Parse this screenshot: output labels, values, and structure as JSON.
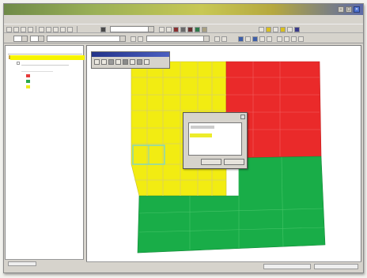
{
  "window": {
    "title": ""
  },
  "menubar": {
    "items": [
      "",
      "",
      "",
      "",
      "",
      "",
      ""
    ]
  },
  "toolbar": {
    "combo_values": [
      "",
      "",
      ""
    ]
  },
  "tree": {
    "root_label": "",
    "items": [
      "",
      "",
      "",
      ""
    ]
  },
  "dialog": {
    "title": "",
    "items": [
      ""
    ],
    "buttons": [
      "",
      ""
    ]
  },
  "colors": {
    "zone_yellow": "#f2ec12",
    "zone_red": "#ea2a2a",
    "zone_green": "#19ad48",
    "grid_line": "#d8d06a",
    "highlight_cyan": "#7fd6c8",
    "titlebar_accent": "#4b5fc0"
  },
  "icons": [
    "minimize-icon",
    "maximize-icon",
    "close-icon",
    "folder-icon",
    "layer-icon"
  ]
}
